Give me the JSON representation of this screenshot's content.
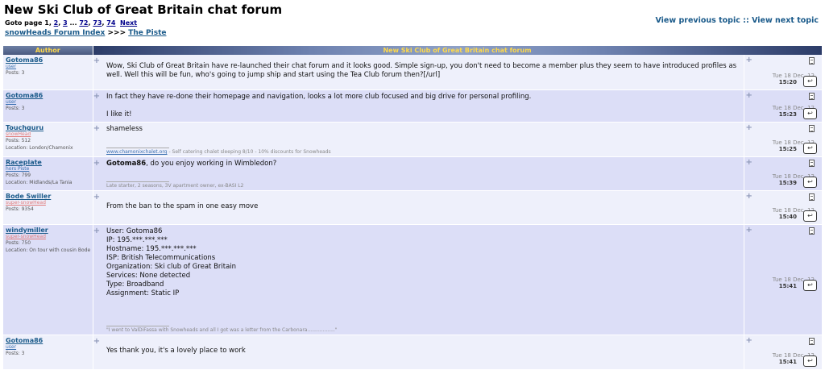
{
  "header": {
    "title": "New Ski Club of Great Britain chat forum",
    "goto_prefix": "Goto page",
    "pages": [
      "1",
      "2",
      "3",
      "...",
      "72",
      "73",
      "74"
    ],
    "next_label": "Next",
    "breadcrumb_index": "snowHeads Forum Index",
    "breadcrumb_sep": ">>>",
    "breadcrumb_forum": "The Piste",
    "prev_topic": "View previous topic",
    "nav_sep": "::",
    "next_topic": "View next topic"
  },
  "table": {
    "author_header": "Author",
    "forum_header": "New Ski Club of Great Britain chat forum"
  },
  "posts": [
    {
      "author": "Gotoma86",
      "rank": "user",
      "posts": "Posts: 3",
      "location": "",
      "body": [
        "Wow, Ski Club of Great Britain have re-launched their chat forum and it looks good. Simple sign-up, you don't need to become a member plus they seem to have introduced profiles as well. Well this will be fun, who's going to jump ship and start using the Tea Club forum then?[/url]"
      ],
      "sig_link": "",
      "sig_text": "",
      "date": "Tue 18 Dec, 12",
      "time": "15:20"
    },
    {
      "author": "Gotoma86",
      "rank": "user",
      "posts": "Posts: 3",
      "location": "",
      "body": [
        "In fact they have re-done their homepage and navigation, looks a lot more club focused and big drive for personal profiling.",
        "",
        "I like it!"
      ],
      "sig_link": "",
      "sig_text": "",
      "date": "Tue 18 Dec, 12",
      "time": "15:23"
    },
    {
      "author": "Touchguru",
      "rank": "snowHead",
      "posts": "Posts: 512",
      "location": "Location: London/Chamonix",
      "body": [
        "shameless"
      ],
      "sig_link": "www.chamonixchalet.org",
      "sig_text": " - Self catering chalet sleeping 8/10 - 10% discounts for Snowheads",
      "date": "Tue 18 Dec, 12",
      "time": "15:25"
    },
    {
      "author": "Raceplate",
      "rank": "hors Piste",
      "posts": "Posts: 799",
      "location": "Location: Midlands/La Tania",
      "body_bold": "Gotoma86",
      "body": [
        ", do you enjoy working in Wimbledon?"
      ],
      "sig_link": "",
      "sig_text": "Late starter, 2 seasons, 3V apartment owner, ex-BASI L2",
      "date": "Tue 18 Dec, 12",
      "time": "15:39"
    },
    {
      "author": "Bode Swiller",
      "rank": "super-snowHead",
      "posts": "Posts: 9354",
      "location": "",
      "body": [
        "From the ban to the spam in one easy move"
      ],
      "sig_link": "",
      "sig_text": "",
      "date": "Tue 18 Dec, 12",
      "time": "15:40"
    },
    {
      "author": "windymiller",
      "rank": "super-snowHead",
      "posts": "Posts: 750",
      "location": "Location: On tour with cousin Bode",
      "body": [
        "User: Gotoma86",
        "IP: 195.***.***.***",
        "Hostname: 195.***.***.***",
        "ISP: British Telecommunications",
        "Organization: Ski club of Great Britain",
        "Services: None detected",
        "Type: Broadband",
        "Assignment: Static IP"
      ],
      "sig_link": "",
      "sig_text": "\"I went to ValDiFassa with Snowheads and all I got was a letter from the Carbonara..................\"",
      "date": "Tue 18 Dec, 12",
      "time": "15:41"
    },
    {
      "author": "Gotoma86",
      "rank": "user",
      "posts": "Posts: 3",
      "location": "",
      "body": [
        "Yes thank you, it's a lovely place to work"
      ],
      "sig_link": "",
      "sig_text": "",
      "date": "Tue 18 Dec, 12",
      "time": "15:41"
    }
  ]
}
